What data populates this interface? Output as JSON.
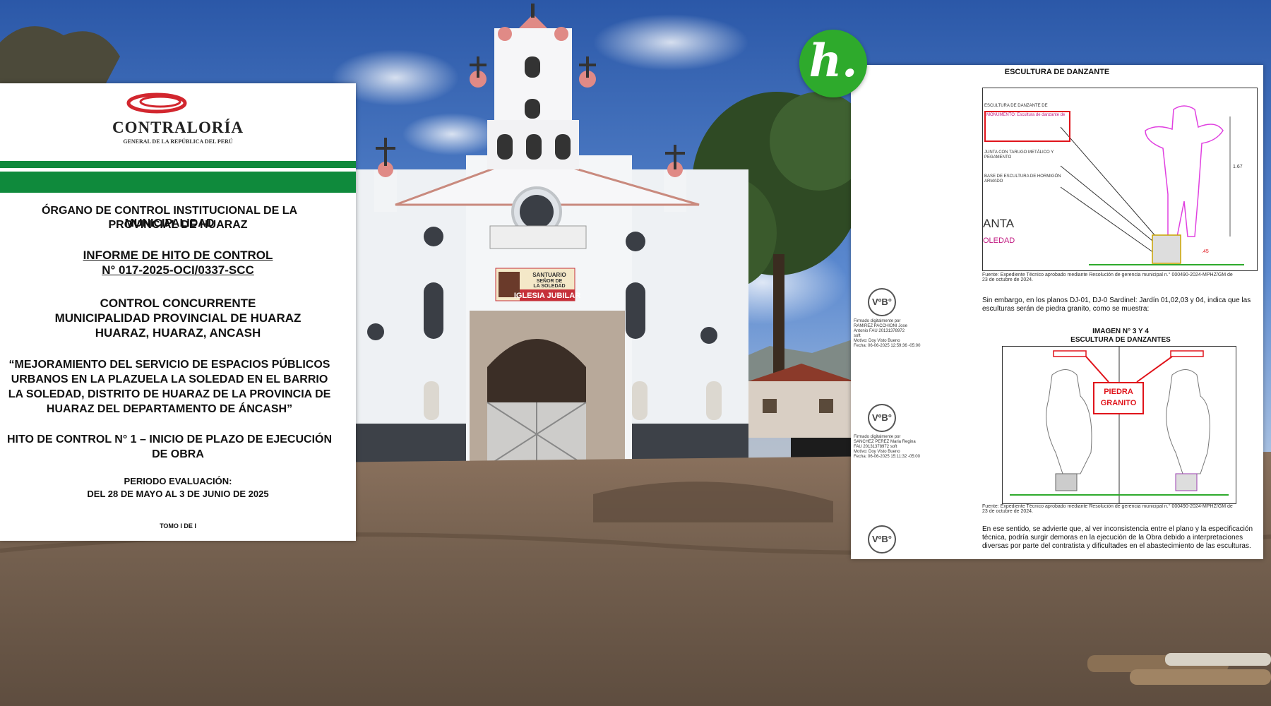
{
  "left_doc": {
    "logo_name": "CONTRALORÍA",
    "logo_sub": "GENERAL DE LA REPÚBLICA DEL PERÚ",
    "org_line1": "ÓRGANO DE CONTROL INSTITUCIONAL DE LA MUNICIPALIDAD",
    "org_line2": "PROVINCIAL DE HUARAZ",
    "report_line1": "INFORME DE HITO DE CONTROL",
    "report_line2": "N° 017-2025-OCI/0337-SCC",
    "control_line1": "CONTROL CONCURRENTE",
    "control_line2": "MUNICIPALIDAD PROVINCIAL DE HUARAZ",
    "control_line3": "HUARAZ, HUARAZ, ANCASH",
    "project_line1": "“MEJORAMIENTO DEL SERVICIO DE ESPACIOS PÚBLICOS",
    "project_line2": "URBANOS EN LA PLAZUELA LA SOLEDAD EN EL BARRIO",
    "project_line3": "LA SOLEDAD, DISTRITO DE HUARAZ DE LA PROVINCIA DE",
    "project_line4": "HUARAZ DEL DEPARTAMENTO DE ÁNCASH”",
    "hito_line1": "HITO DE CONTROL N° 1 – INICIO DE PLAZO DE EJECUCIÓN",
    "hito_line2": "DE OBRA",
    "period_line1": "PERIODO EVALUACIÓN:",
    "period_line2": "DEL 28 DE MAYO AL 3 DE JUNIO DE 2025",
    "tomo": "TOMO I DE I"
  },
  "right_doc": {
    "title": "ESCULTURA DE DANZANTE",
    "label_escultura": "ESCULTURA DE DANZANTE DE",
    "label_monumento": "MONUMENTO: Escultura de danzante de",
    "label_junta": "JUNTA CON TARUGO METÁLICO Y PEGAMENTO",
    "label_base": "BASE DE ESCULTURA DE HORMIGÓN ARMADO",
    "dim_height": "1.67",
    "dim_base": ".45",
    "frag_anta": "ANTA",
    "frag_oledad": "OLEDAD",
    "fuente1_a": "Fuente: Expediente Técnico aprobado mediante Resolución de gerencia municipal n.° 000490-2024-MPHZ/GM de",
    "fuente1_b": "23 de octubre de 2024.",
    "para1_a": "Sin embargo, en los planos DJ-01, DJ-0 Sardinel: Jardín 01,02,03 y 04, indica que las",
    "para1_b": "esculturas serán de piedra granito, como se muestra:",
    "imagen_label": "IMAGEN N° 3 Y 4",
    "imagen_title": "ESCULTURA DE DANZANTES",
    "stamp_line1": "PIEDRA",
    "stamp_line2": "GRANITO",
    "fuente2_a": "Fuente: Expediente Técnico aprobado mediante Resolución de gerencia municipal n.° 000490-2024-MPHZ/GM de",
    "fuente2_b": "23 de octubre de 2024.",
    "para2_a": "En ese sentido, se advierte que, al ver inconsistencia entre el plano y la especificación",
    "para2_b": "técnica, podría surgir demoras en la ejecución de la Obra debido a interpretaciones",
    "para2_c": "diversas por parte del contratista y dificultades en el abastecimiento de las esculturas.",
    "vb_label": "VºB°",
    "sig1_a": "Firmado digitalmente por",
    "sig1_b": "RAMIREZ PACCHIONI Jose",
    "sig1_c": "Antonio FAU 20131378972",
    "sig1_d": "soft",
    "sig1_e": "Motivo: Doy Visto Bueno",
    "sig1_f": "Fecha: 06-06-2025 12:59:36 -05:00",
    "sig2_a": "Firmado digitalmente por",
    "sig2_b": "SANCHEZ PEREZ Maria Regina",
    "sig2_c": "FAU 20131378972 soft",
    "sig2_d": "Motivo: Doy Visto Bueno",
    "sig2_e": "Fecha: 06-06-2025 15:11:32 -05:00"
  },
  "banner": {
    "line1": "SANTUARIO",
    "line2": "SEÑOR DE",
    "line3": "LA SOLEDAD",
    "line4": "IGLESIA JUBILAR"
  },
  "brand_logo": "h.",
  "colors": {
    "sky_top": "#2f5fb0",
    "church_white": "#f4f6f8",
    "dome_red": "#e08a86",
    "ground": "#7a6250",
    "contraloria_green": "#0f8a3c",
    "stamp_red": "#e0141b",
    "brand_green": "#2eaa2c"
  }
}
